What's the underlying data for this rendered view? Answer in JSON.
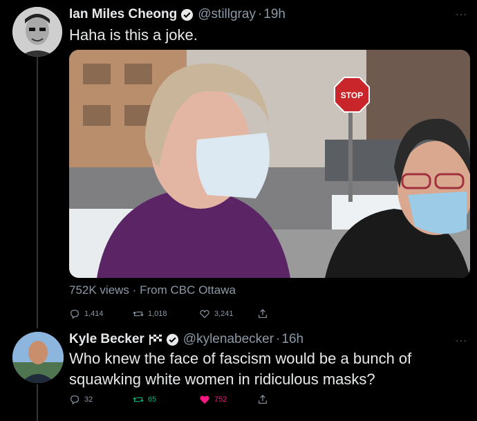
{
  "tweet1": {
    "name": "Ian Miles Cheong",
    "handle": "@stillgray",
    "time": "19h",
    "text": "Haha is this a joke.",
    "views": "752K views",
    "source": "From CBC Ottawa",
    "stop_sign": "STOP",
    "replies": "1,414",
    "retweets": "1,018",
    "likes": "3,241"
  },
  "tweet2": {
    "name": "Kyle Becker",
    "handle": "@kylenabecker",
    "time": "16h",
    "text_line1": "Who knew the face of fascism would be a bunch of",
    "text_line2": "squawking white women in ridiculous masks?",
    "replies": "32",
    "retweets": "65",
    "likes": "752"
  },
  "colors": {
    "accent": "#1d9bf0",
    "like": "#f91880",
    "retweet": "#00ba7c",
    "muted": "#8b98a5"
  },
  "icons": [
    "verified-icon",
    "checkered-flag-icon",
    "reply-icon",
    "retweet-icon",
    "like-icon",
    "share-icon",
    "more-icon"
  ]
}
